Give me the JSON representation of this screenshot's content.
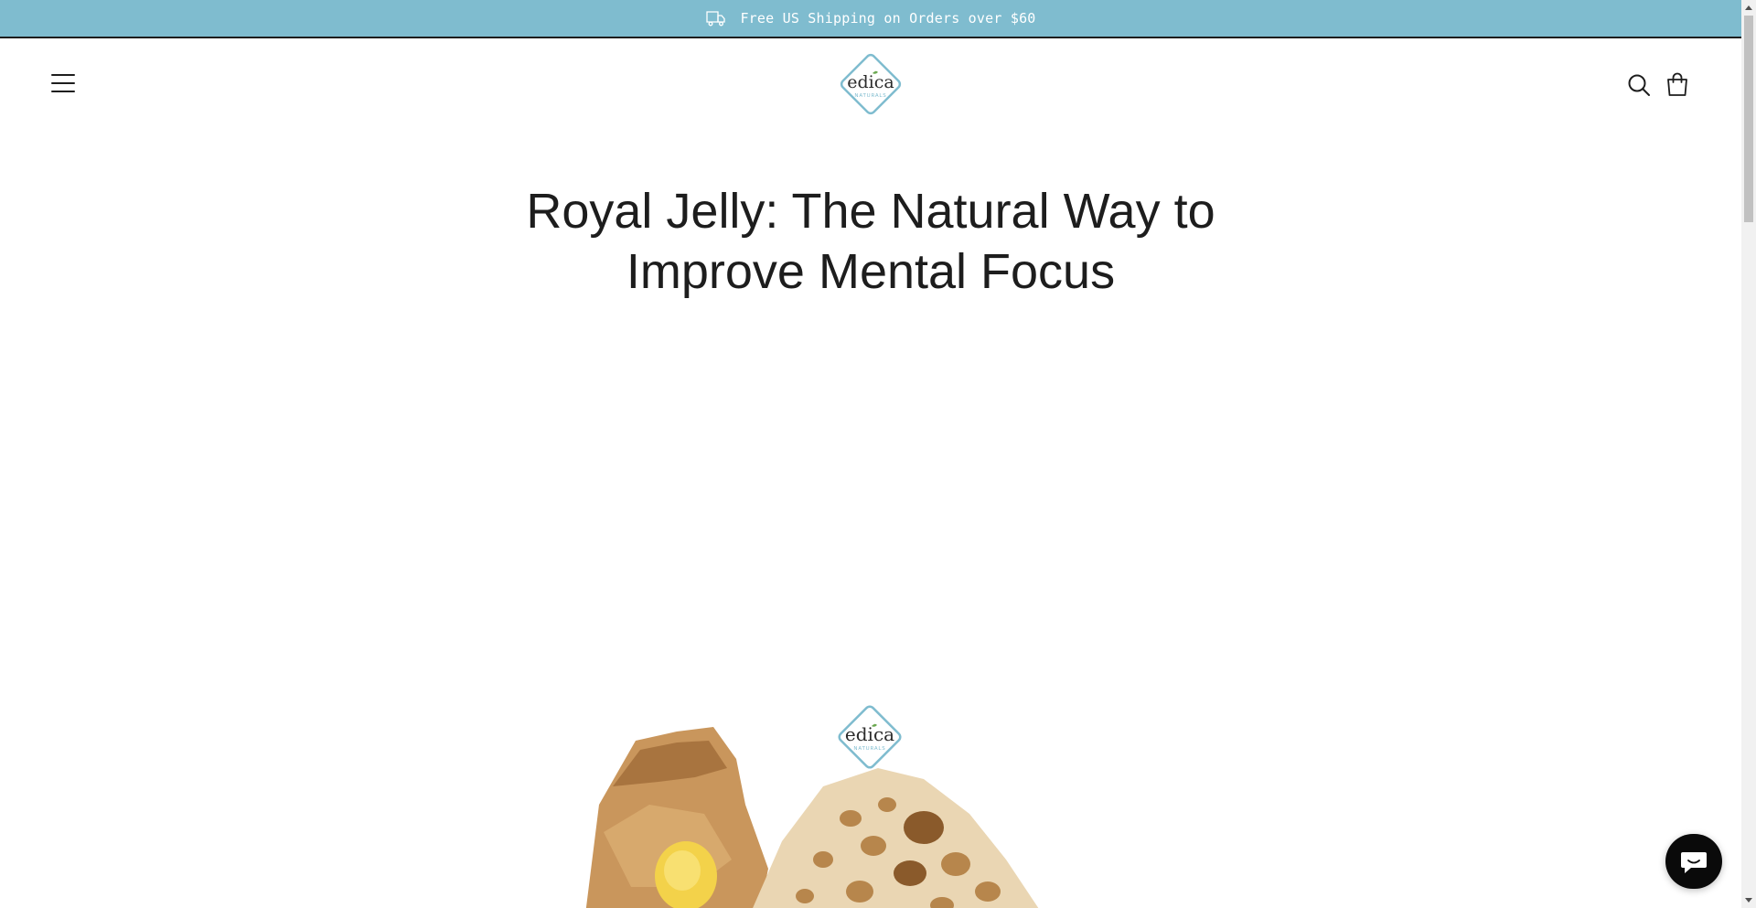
{
  "announcement": {
    "text": "Free US Shipping on Orders over $60",
    "icon": "truck-icon",
    "background": "#7fbccf"
  },
  "header": {
    "menu_icon": "hamburger-icon",
    "logo": {
      "brand_word": "edica",
      "sub_word": "NATURALS",
      "border_color": "#7fbccf",
      "leaf_color": "#6aa84f"
    },
    "search_icon": "search-icon",
    "cart_icon": "shopping-bag-icon"
  },
  "article": {
    "title_line1": "Royal Jelly: The Natural Way to",
    "title_line2": "Improve Mental Focus",
    "hero_image": "honeycomb with royal jelly photo"
  },
  "chat": {
    "icon": "chat-bubble-icon",
    "background": "#0a0a0a"
  }
}
